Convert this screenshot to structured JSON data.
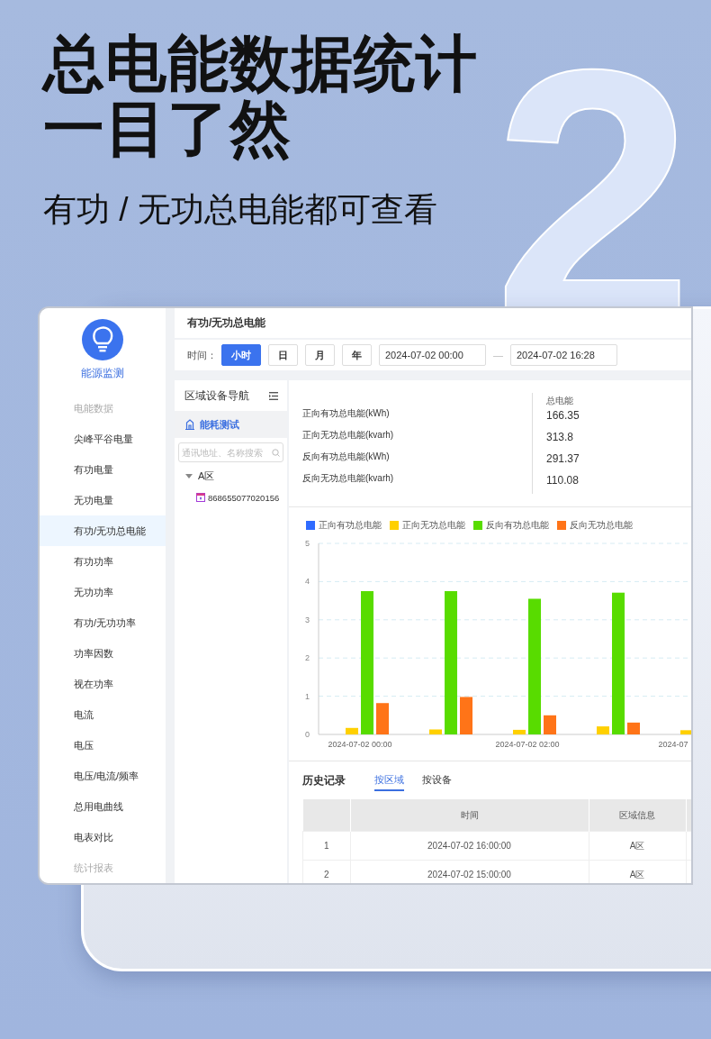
{
  "headline": [
    "总电能数据统计",
    "一目了然"
  ],
  "subtitle": "有功 / 无功总电能都可查看",
  "decor_number": "2",
  "app": {
    "brand": "能源监测",
    "sidebar": {
      "items": [
        {
          "kind": "group",
          "label": "电能数据",
          "selected": false
        },
        {
          "kind": "item",
          "label": "尖峰平谷电量",
          "selected": false
        },
        {
          "kind": "item",
          "label": "有功电量",
          "selected": false
        },
        {
          "kind": "item",
          "label": "无功电量",
          "selected": false
        },
        {
          "kind": "item",
          "label": "有功/无功总电能",
          "selected": true
        },
        {
          "kind": "item",
          "label": "有功功率",
          "selected": false
        },
        {
          "kind": "item",
          "label": "无功功率",
          "selected": false
        },
        {
          "kind": "item",
          "label": "有功/无功功率",
          "selected": false
        },
        {
          "kind": "item",
          "label": "功率因数",
          "selected": false
        },
        {
          "kind": "item",
          "label": "视在功率",
          "selected": false
        },
        {
          "kind": "item",
          "label": "电流",
          "selected": false
        },
        {
          "kind": "item",
          "label": "电压",
          "selected": false
        },
        {
          "kind": "item",
          "label": "电压/电流/频率",
          "selected": false
        },
        {
          "kind": "item",
          "label": "总用电曲线",
          "selected": false
        },
        {
          "kind": "item",
          "label": "电表对比",
          "selected": false
        },
        {
          "kind": "group",
          "label": "统计报表",
          "selected": false
        }
      ]
    },
    "page_title": "有功/无功总电能",
    "toolbar": {
      "label": "时间：",
      "periods": [
        {
          "label": "小时",
          "selected": true
        },
        {
          "label": "日",
          "selected": false
        },
        {
          "label": "月",
          "selected": false
        },
        {
          "label": "年",
          "selected": false
        }
      ],
      "start": "2024-07-02 00:00",
      "separator": "—",
      "end": "2024-07-02 16:28"
    },
    "nav": {
      "title": "区域设备导航",
      "root": {
        "label": "能耗测试",
        "selected": true
      },
      "search": {
        "placeholder": "通讯地址、名称搜索"
      },
      "tree": [
        {
          "label": "A区",
          "expanded": true,
          "children": [
            {
              "label": "868655077020156"
            }
          ]
        }
      ]
    },
    "summary": {
      "header": "总电能",
      "rows": [
        {
          "label": "正向有功总电能(kWh)",
          "value": "166.35"
        },
        {
          "label": "正向无功总电能(kvarh)",
          "value": "313.8"
        },
        {
          "label": "反向有功总电能(kWh)",
          "value": "291.37"
        },
        {
          "label": "反向无功总电能(kvarh)",
          "value": "110.08"
        }
      ]
    },
    "chart": {
      "chart_data": {
        "type": "bar",
        "categories": [
          "2024-07-02 00:00",
          null,
          "2024-07-02 02:00",
          null,
          "2024-07"
        ],
        "ylim": [
          0,
          5
        ],
        "grid": true,
        "legend": "top",
        "yticks": [
          0,
          1,
          2,
          3,
          4,
          5
        ],
        "series": [
          {
            "name": "正向有功总电能",
            "color": "#2f6bff",
            "values": [
              0,
              0,
              0,
              0,
              null
            ]
          },
          {
            "name": "正向无功总电能",
            "color": "#ffd000",
            "values": [
              0.17,
              0.13,
              0.12,
              0.21,
              0.11
            ]
          },
          {
            "name": "反向有功总电能",
            "color": "#58dc00",
            "values": [
              3.75,
              3.75,
              3.55,
              3.71,
              null
            ]
          },
          {
            "name": "反向无功总电能",
            "color": "#ff7418",
            "values": [
              0.82,
              0.98,
              0.5,
              0.31,
              null
            ]
          }
        ]
      }
    },
    "history": {
      "title": "历史记录",
      "tabs": [
        {
          "label": "按区域",
          "selected": true
        },
        {
          "label": "按设备",
          "selected": false
        }
      ],
      "table": {
        "columns": [
          "时间",
          "区域信息"
        ],
        "rows": [
          {
            "index": "1",
            "time": "2024-07-02 16:00:00",
            "area": "A区"
          },
          {
            "index": "2",
            "time": "2024-07-02 15:00:00",
            "area": "A区"
          }
        ]
      }
    }
  }
}
